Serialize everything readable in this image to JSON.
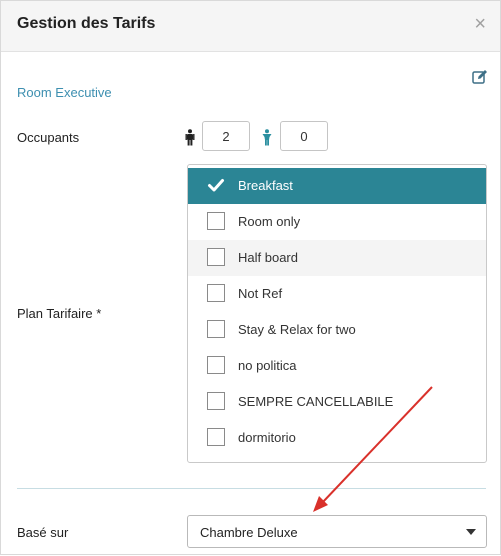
{
  "modal": {
    "title": "Gestion des Tarifs",
    "close_glyph": "×"
  },
  "room": {
    "name": "Room Executive"
  },
  "occupants": {
    "label": "Occupants",
    "adults": "2",
    "children": "0"
  },
  "plan": {
    "label": "Plan Tarifaire  *",
    "items": [
      {
        "label": "Breakfast",
        "checked": true,
        "state": "selected"
      },
      {
        "label": "Room only",
        "checked": false
      },
      {
        "label": "Half board",
        "checked": false,
        "state": "hover"
      },
      {
        "label": "Not Ref",
        "checked": false
      },
      {
        "label": "Stay & Relax for two",
        "checked": false
      },
      {
        "label": "no politica",
        "checked": false
      },
      {
        "label": "SEMPRE CANCELLABILE",
        "checked": false
      },
      {
        "label": "dormitorio",
        "checked": false
      }
    ]
  },
  "base": {
    "label": "Basé sur",
    "selected": "Chambre Deluxe"
  },
  "colors": {
    "accent": "#2b8595",
    "link": "#3d8fb0",
    "annotation_arrow": "#d9312b"
  },
  "icons": [
    "close-icon",
    "edit-icon",
    "adult-icon",
    "child-icon",
    "check-icon",
    "caret-down-icon"
  ]
}
